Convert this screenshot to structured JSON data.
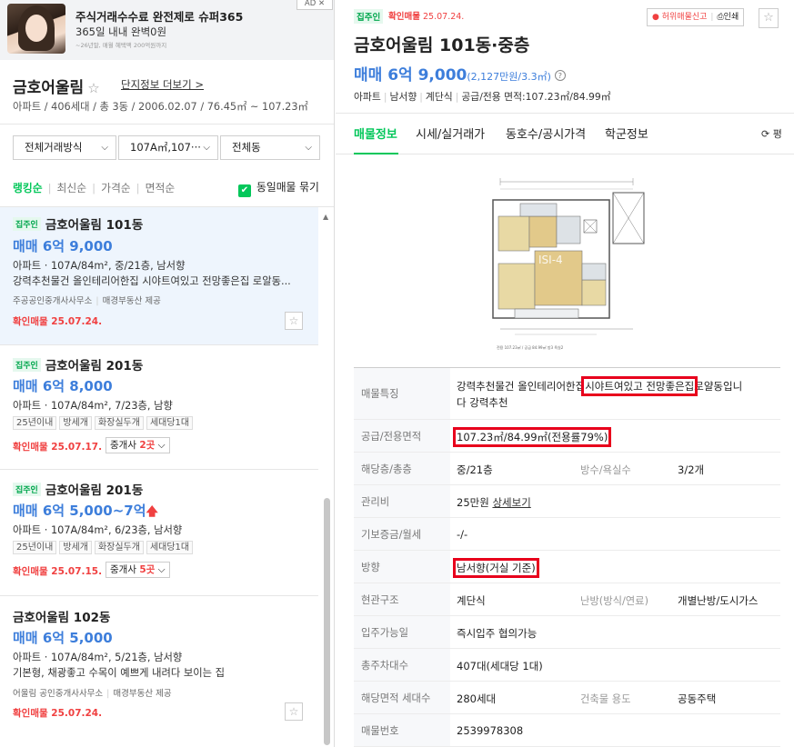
{
  "ad": {
    "title": "주식거래수수료 완전제로 슈퍼365",
    "subtitle": "365일 내내 완벽0원",
    "fine_print": "~26년말, 매월 혜택액 200억원까지",
    "badge": "AD ✕"
  },
  "complex": {
    "name": "금호어울림",
    "more_link": "단지정보 더보기 >",
    "info": "아파트 / 406세대 / 총 3동 / 2006.02.07 / 76.45㎡ ~ 107.23㎡"
  },
  "filters": {
    "trade_type": "전체거래방식",
    "area": "107A㎡,107···",
    "building": "전체동"
  },
  "sort": {
    "items": [
      "랭킹순",
      "최신순",
      "가격순",
      "면적순"
    ],
    "group_label": "동일매물 묶기"
  },
  "listings": [
    {
      "owner_tag": "집주인",
      "title": "금호어울림 101동",
      "price": "매매 6억 9,000",
      "spec": "아파트 · 107A/84m², 중/21층, 남서향",
      "desc": "강력추천물건 올인테리어한집 시야트여있고 전망좋은집 로알동...",
      "agent": "주공공인중개사사무소",
      "provider": "매경부동산 제공",
      "confirm": "확인매물 25.07.24."
    },
    {
      "owner_tag": "집주인",
      "title": "금호어울림 201동",
      "price": "매매 6억 8,000",
      "spec": "아파트 · 107A/84m², 7/23층, 남향",
      "tags": [
        "25년이내",
        "방세개",
        "화장실두개",
        "세대당1대"
      ],
      "confirm": "확인매물 25.07.17.",
      "broker_label": "중개사",
      "broker_count": "2곳"
    },
    {
      "owner_tag": "집주인",
      "title": "금호어울림 201동",
      "price": "매매 6억 5,000~7억",
      "spec": "아파트 · 107A/84m², 6/23층, 남서향",
      "tags": [
        "25년이내",
        "방세개",
        "화장실두개",
        "세대당1대"
      ],
      "confirm": "확인매물 25.07.15.",
      "broker_label": "중개사",
      "broker_count": "5곳"
    },
    {
      "title": "금호어울림 102동",
      "price": "매매 6억 5,000",
      "spec": "아파트 · 107A/84m², 5/21층, 남서향",
      "desc": "기본형, 채광좋고 수목이 예쁘게 내려다 보이는 집",
      "agent": "어울림 공인중개사사무소",
      "provider": "매경부동산 제공",
      "confirm": "확인매물 25.07.24."
    }
  ],
  "detail": {
    "owner_tag": "집주인",
    "confirm_label": "확인매물",
    "confirm_date": "25.07.24.",
    "report": "허위매물신고",
    "print": "인쇄",
    "title": "금호어울림 101동·중층",
    "price": "매매 6억 9,000",
    "price_per": "(2,127만원/3.3㎡)",
    "spec": [
      "아파트",
      "남서향",
      "계단식",
      "공급/전용 면적:107.23㎡/84.99㎡"
    ],
    "tabs": [
      "매물정보",
      "시세/실거래가",
      "동호수/공시가격",
      "학군정보"
    ],
    "tab_right": "평",
    "plan_caption": "전용 107.23㎡ / 공급 84.99㎡ 방3 욕실2",
    "plan_watermark": "ISI-4"
  },
  "info_rows": {
    "feature_label": "매물특징",
    "feature_val_a": "강력추천물건 올인테리어한집",
    "feature_val_b": "시야트여있고 전망좋은집",
    "feature_val_c": "로얄동입니",
    "feature_val_d": "다 강력추천",
    "area_label": "공급/전용면적",
    "area_val": "107.23㎡/84.99㎡(전용률79%)",
    "floor_label": "해당층/총층",
    "floor_val": "중/21층",
    "rooms_label": "방수/욕실수",
    "rooms_val": "3/2개",
    "fee_label": "관리비",
    "fee_val": "25만원",
    "fee_link": "상세보기",
    "deposit_label": "기보증금/월세",
    "deposit_val": "-/-",
    "dir_label": "방향",
    "dir_val": "남서향(거실 기준)",
    "entry_label": "현관구조",
    "entry_val": "계단식",
    "heat_label": "난방(방식/연료)",
    "heat_val": "개별난방/도시가스",
    "move_label": "입주가능일",
    "move_val": "즉시입주 협의가능",
    "parking_label": "총주차대수",
    "parking_val": "407대(세대당 1대)",
    "units_label": "해당면적 세대수",
    "units_val": "280세대",
    "use_label": "건축물 용도",
    "use_val": "공동주택",
    "no_label": "매물번호",
    "no_val": "2539978308"
  }
}
